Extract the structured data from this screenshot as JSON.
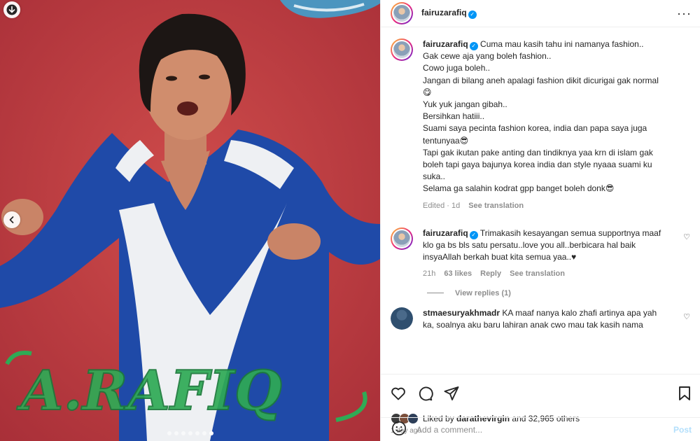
{
  "media": {
    "poster_text": "A.RAFIQ",
    "slide_count": 7,
    "active_slide": 7,
    "colors": {
      "background": "#c0393e",
      "outfit_blue": "#1f4aa8",
      "outfit_white": "#f2f2f2",
      "logo_green": "#2faa55"
    }
  },
  "header": {
    "username": "fairuzarafiq",
    "verified_icon": "verified-badge-icon",
    "more_icon": "more-options-icon"
  },
  "caption": {
    "username": "fairuzarafiq",
    "lines": [
      "Cuma mau kasih tahu ini namanya fashion..",
      "Gak cewe aja yang boleh fashion..",
      "Cowo juga boleh..",
      "Jangan di bilang aneh apalagi fashion dikit dicurigai gak normal",
      "😋",
      "Yuk yuk jangan gibah..",
      "Bersihkan hatiii..",
      "Suami saya pecinta fashion korea, india dan papa saya juga",
      "tentunyaa😎",
      "Tapi gak ikutan pake anting dan tindiknya yaa krn di islam gak",
      "boleh tapi gaya bajunya korea india dan style nyaaa suami ku",
      "suka..",
      "Selama ga salahin kodrat gpp banget boleh donk😎"
    ],
    "edited": "Edited · 1d",
    "see_translation": "See translation"
  },
  "comments": [
    {
      "username": "fairuzarafiq",
      "lines": [
        "Trimakasih kesayangan semua supportnya maaf",
        "klo ga bs bls satu persatu..love you all..berbicara hal baik",
        "insyaAllah berkah buat kita semua yaa..♥"
      ],
      "time": "21h",
      "likes": "63 likes",
      "reply": "Reply",
      "see_translation": "See translation",
      "view_replies": "View replies (1)"
    },
    {
      "username": "stmaesuryakhmadr",
      "lines": [
        "KA maaf nanya kalo zhafi artinya apa yah",
        "ka, soalnya aku baru lahiran anak cwo mau tak kasih nama"
      ]
    }
  ],
  "actions": {
    "like_icon": "heart-icon",
    "comment_icon": "comment-icon",
    "share_icon": "share-icon",
    "save_icon": "bookmark-icon"
  },
  "likes": {
    "prefix": "Liked by",
    "user": "darathevirgin",
    "rest": "and 32,965 others"
  },
  "time_ago": "1 day ago",
  "add_comment": {
    "placeholder": "Add a comment...",
    "post_label": "Post",
    "emoji_icon": "emoji-icon"
  }
}
